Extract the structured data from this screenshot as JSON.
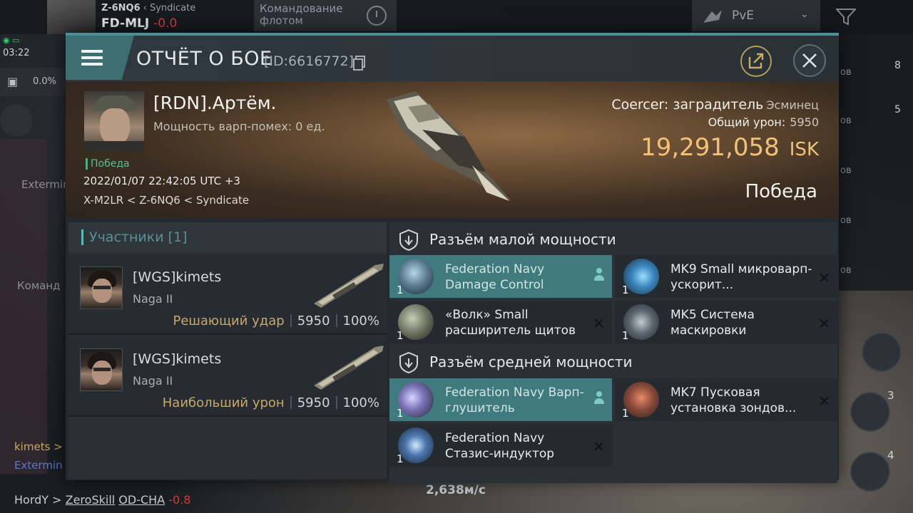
{
  "hud": {
    "system_top": "Z-6NQ6",
    "alliance_top": "Syndicate",
    "system_name": "FD-MLJ",
    "system_sec": "-0.0",
    "fleet_btn": "Командование флотом",
    "mode": "PvE",
    "time": "03:22",
    "cargo_pct": "0.0%",
    "left_text_1": "Extermin",
    "left_text_2": "Команд",
    "left_text_3": "kimets >",
    "left_text_4": "Extermin",
    "right_labels": [
      "ов",
      "ов",
      "ов",
      "ов",
      "ов"
    ],
    "right_nums": [
      "8",
      "5"
    ],
    "bottom_pilot": "HordY",
    "bottom_name": "ZeroSkill",
    "bottom_sys": "OD-CHA",
    "bottom_sec": "-0.8",
    "speed": "2,638м/с",
    "round_nums": [
      "3",
      "4"
    ]
  },
  "dialog": {
    "title": "ОТЧЁТ О БОЕ",
    "id": "[ID:6616772]"
  },
  "banner": {
    "pilot_name": "[RDN].Артём.",
    "warp_text": "Мощность варп-помех: 0 ед.",
    "victory_tag": "Победа",
    "date": "2022/01/07 22:42:05 UTC +3",
    "location": "X-M2LR < Z-6NQ6 < Syndicate",
    "ship_line": "Coercer: заградитель",
    "ship_class": "Эсминец",
    "damage_label": "Общий урон:",
    "damage_value": "5950",
    "isk_value": "19,291,058",
    "isk_unit": "ISK",
    "result": "Победа"
  },
  "participants": {
    "header": "Участники [1]",
    "rows": [
      {
        "name": "[WGS]kimets",
        "ship": "Naga II",
        "role": "Решающий удар",
        "damage": "5950",
        "pct": "100%"
      },
      {
        "name": "[WGS]kimets",
        "ship": "Naga II",
        "role": "Наибольший урон",
        "damage": "5950",
        "pct": "100%"
      }
    ]
  },
  "modules": {
    "low_title": "Разъём малой мощности",
    "mid_title": "Разъём средней мощности",
    "low": [
      {
        "qty": "1",
        "name": "Federation Navy Damage Control"
      },
      {
        "qty": "1",
        "name": "MK9 Small микроварп-ускорит..."
      },
      {
        "qty": "1",
        "name": "«Волк» Small расширитель щитов"
      },
      {
        "qty": "1",
        "name": "MK5 Система маскировки"
      }
    ],
    "mid": [
      {
        "qty": "1",
        "name": "Federation Navy Варп-глушитель"
      },
      {
        "qty": "1",
        "name": "MK7 Пусковая установка зондов..."
      },
      {
        "qty": "1",
        "name": "Federation Navy Стазис-индуктор"
      }
    ]
  }
}
